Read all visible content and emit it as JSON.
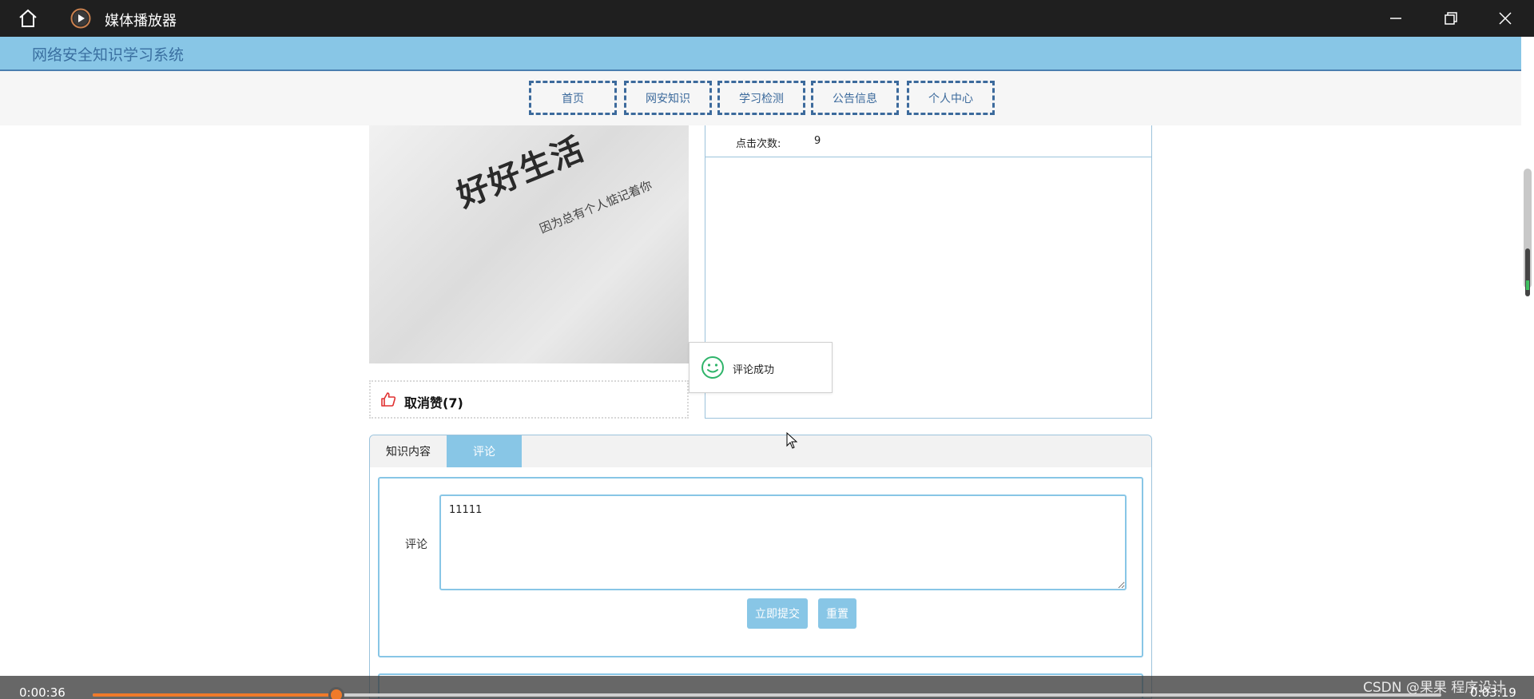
{
  "window": {
    "title": "媒体播放器",
    "home_icon": "home-icon",
    "app_icon": "play-circle-icon"
  },
  "site": {
    "title": "网络安全知识学习系统"
  },
  "nav": {
    "items": [
      "首页",
      "网安知识",
      "学习检测",
      "公告信息",
      "个人中心"
    ]
  },
  "image": {
    "text_main": "好好生活",
    "text_sub": "因为总有个人惦记着你"
  },
  "like": {
    "label": "取消赞(7)",
    "icon": "thumbs-up-icon"
  },
  "info": {
    "rows": [
      {
        "label": "点击次数:",
        "value": "9"
      }
    ]
  },
  "toast": {
    "message": "评论成功",
    "icon": "smile-icon"
  },
  "tabs": {
    "items": [
      "知识内容",
      "评论"
    ],
    "active": 1
  },
  "form": {
    "comment_label": "评论",
    "comment_value": "11111",
    "submit_label": "立即提交",
    "reset_label": "重置"
  },
  "player": {
    "current_time": "0:00:36",
    "total_time": "0:03:19",
    "progress": 0.1809,
    "watermark": "CSDN @果果 程序设计"
  },
  "colors": {
    "accent": "#88c6e6",
    "nav_border": "#3c6a9c",
    "progress": "#f07a2a",
    "titlebar": "#1f1f1f"
  }
}
